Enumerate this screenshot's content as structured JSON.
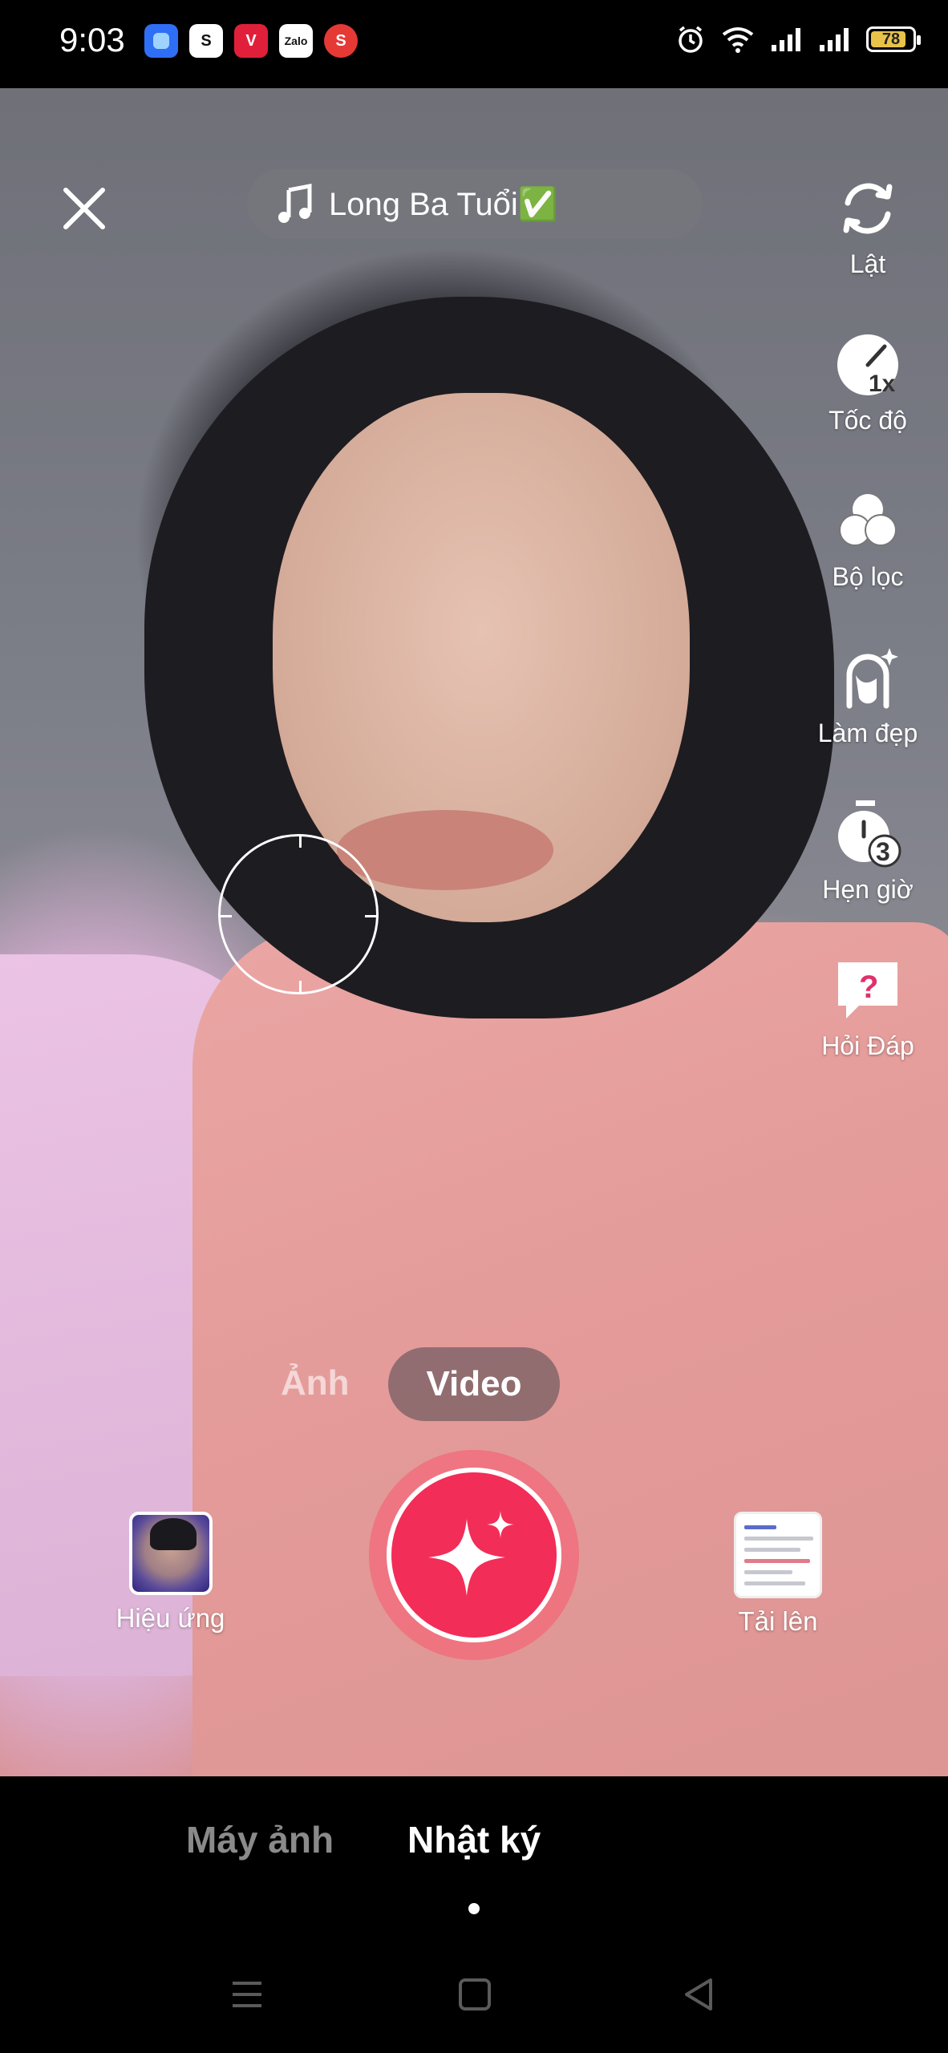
{
  "status_bar": {
    "time": "9:03",
    "apps": [
      {
        "icon": "messenger-app-icon",
        "color": "#2f6ff5",
        "text": ""
      },
      {
        "icon": "shopee-app-icon",
        "color": "#ffffff",
        "text": "S"
      },
      {
        "icon": "v-app-icon",
        "color": "#e0203a",
        "text": "V"
      },
      {
        "icon": "zalo-app-icon",
        "color": "#ffffff",
        "text": "Zalo"
      },
      {
        "icon": "s-red-app-icon",
        "color": "#e53935",
        "text": "S"
      }
    ],
    "battery": "78"
  },
  "header": {
    "music_title": "Long Ba Tuổi✅"
  },
  "tools": [
    {
      "label": "Lật",
      "icon": "flip-camera-icon"
    },
    {
      "label": "Tốc độ",
      "icon": "speed-icon",
      "badge": "1x"
    },
    {
      "label": "Bộ lọc",
      "icon": "filters-icon"
    },
    {
      "label": "Làm đẹp",
      "icon": "beautify-icon"
    },
    {
      "label": "Hẹn giờ",
      "icon": "timer-icon",
      "badge": "3"
    },
    {
      "label": "Hỏi Đáp",
      "icon": "qa-icon",
      "badge": "?"
    }
  ],
  "modes": {
    "photo": "Ảnh",
    "video": "Video"
  },
  "bottom_controls": {
    "effects_label": "Hiệu ứng",
    "upload_label": "Tải lên"
  },
  "bottom_tabs": {
    "camera": "Máy ảnh",
    "diary": "Nhật ký"
  },
  "colors": {
    "record": "#f22d57",
    "battery": "#e8c34a"
  }
}
